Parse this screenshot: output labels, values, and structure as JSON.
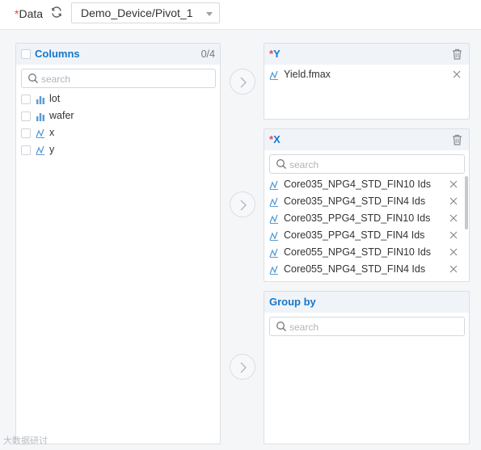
{
  "toolbar": {
    "required_mark": "*",
    "data_label": "Data",
    "dataset_value": "Demo_Device/Pivot_1"
  },
  "columns_panel": {
    "title": "Columns",
    "count": "0/4",
    "search_placeholder": "search",
    "items": [
      {
        "name": "lot",
        "type": "bar"
      },
      {
        "name": "wafer",
        "type": "bar"
      },
      {
        "name": "x",
        "type": "measure"
      },
      {
        "name": "y",
        "type": "measure"
      }
    ]
  },
  "y_panel": {
    "required_mark": "*",
    "title": "Y",
    "fields": [
      "Yield.fmax"
    ]
  },
  "x_panel": {
    "required_mark": "*",
    "title": "X",
    "search_placeholder": "search",
    "fields": [
      "Core035_NPG4_STD_FIN10 Ids",
      "Core035_NPG4_STD_FIN4 Ids",
      "Core035_PPG4_STD_FIN10 Ids",
      "Core035_PPG4_STD_FIN4 Ids",
      "Core055_NPG4_STD_FIN10 Ids",
      "Core055_NPG4_STD_FIN4 Ids"
    ]
  },
  "groupby_panel": {
    "title": "Group by",
    "search_placeholder": "search"
  },
  "icons": {
    "refresh": "refresh-icon",
    "trash": "trash-icon",
    "search": "search-icon",
    "bar": "bar-chart-icon",
    "measure": "measure-icon",
    "remove": "close-icon",
    "arrow": "chevron-right-icon"
  },
  "colors": {
    "accent": "#1677c9",
    "required": "#e5484d",
    "type_icon": "#5b9bd5"
  },
  "watermark": "大数据研讨"
}
